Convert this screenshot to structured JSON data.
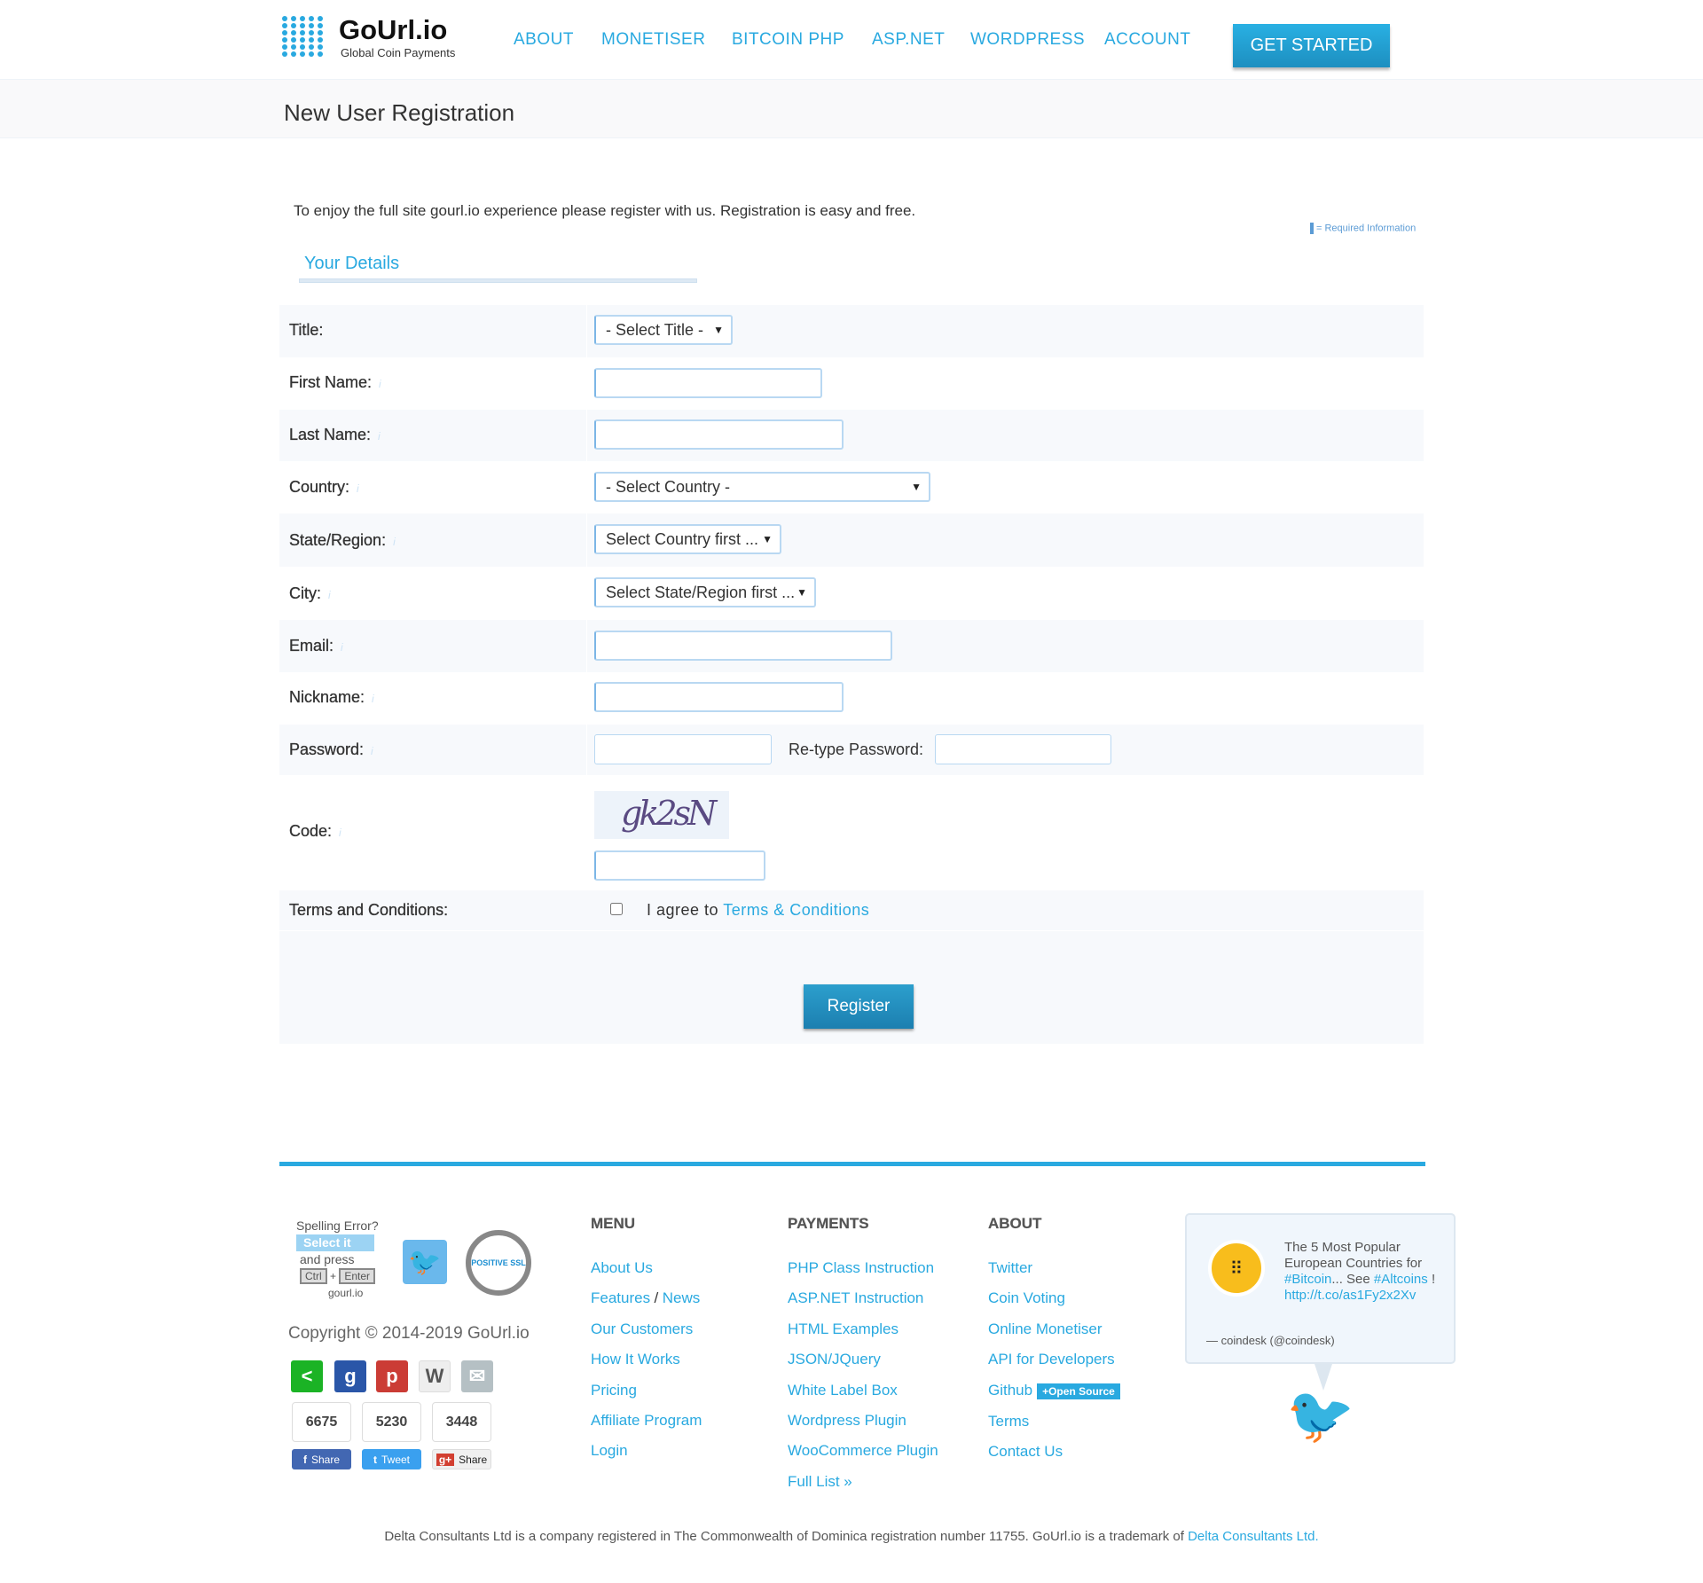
{
  "header": {
    "logo_name": "GoUrl.io",
    "logo_sub": "Global Coin Payments",
    "nav": [
      "ABOUT",
      "MONETISER",
      "BITCOIN PHP",
      "ASP.NET",
      "WORDPRESS",
      "ACCOUNT"
    ],
    "cta": "GET STARTED"
  },
  "page_title": "New User Registration",
  "intro": "To enjoy the full site gourl.io experience please register with us.  Registration is easy and free.",
  "required_note": "= Required Information",
  "section_title": "Your Details",
  "form": {
    "title_label": "Title:",
    "title_value": "- Select Title -",
    "first_name_label": "First Name:",
    "first_name_value": "",
    "last_name_label": "Last Name:",
    "last_name_value": "",
    "country_label": "Country:",
    "country_value": "- Select Country -",
    "state_label": "State/Region:",
    "state_value": "Select Country first ...",
    "city_label": "City:",
    "city_value": "Select State/Region first ...",
    "email_label": "Email:",
    "email_value": "",
    "nickname_label": "Nickname:",
    "nickname_value": "",
    "password_label": "Password:",
    "password_value": "",
    "retype_label": "Re-type Password:",
    "retype_value": "",
    "code_label": "Code:",
    "captcha_text": "gk2sN",
    "code_value": "",
    "terms_label": "Terms and Conditions:",
    "agree_text": "I agree to",
    "terms_link": "Terms & Conditions",
    "agree_checked": false,
    "register": "Register",
    "info_icon": "i"
  },
  "footer": {
    "spelling": {
      "line1": "Spelling Error?",
      "line2": "Select it",
      "line3": "and press",
      "ctrl": "Ctrl",
      "plus": "+",
      "enter": "Enter",
      "brand": "gourl.io"
    },
    "ssl_badge": "POSITIVE SSL",
    "copyright": "Copyright © 2014-2019 GoUrl.io",
    "counts": [
      "6675",
      "5230",
      "3448"
    ],
    "share_buttons": [
      "Share",
      "Tweet",
      "Share"
    ],
    "menu": {
      "heading": "MENU",
      "links": [
        "About Us",
        "Features",
        "News",
        "Our Customers",
        "How It Works",
        "Pricing",
        "Affiliate Program",
        "Login"
      ]
    },
    "payments": {
      "heading": "PAYMENTS",
      "links": [
        "PHP Class Instruction",
        "ASP.NET Instruction",
        "HTML Examples",
        "JSON/JQuery",
        "White Label Box",
        "Wordpress Plugin",
        "WooCommerce Plugin",
        "Full List »"
      ]
    },
    "about": {
      "heading": "ABOUT",
      "links": [
        "Twitter",
        "Coin Voting",
        "Online Monetiser",
        "API for Developers",
        "Github",
        "Terms",
        "Contact Us"
      ],
      "badge": "+Open Source"
    },
    "tweet": {
      "t1": "The 5 Most Popular European Countries for ",
      "h1": "#Bitcoin",
      "t2": "... See ",
      "h2": "#Altcoins",
      "t3": " ! ",
      "link": "http://t.co/as1Fy2x2Xv",
      "author": "— coindesk (@coindesk)"
    },
    "legal": "Delta Consultants Ltd is a company registered in The Commonwealth of Dominica registration number 11755. GoUrl.io is a trademark of ",
    "legal_link": "Delta Consultants Ltd."
  },
  "colors": {
    "accent": "#29a9e0",
    "button": "#1d8fc0",
    "row_alt": "#f7f9fc"
  }
}
